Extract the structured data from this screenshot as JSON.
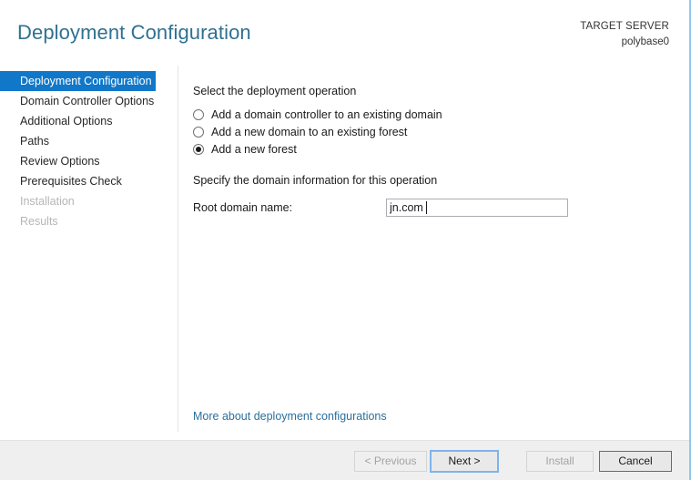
{
  "header": {
    "title": "Deployment Configuration",
    "target_server_label": "TARGET SERVER",
    "target_server_name": "polybase0"
  },
  "sidebar": {
    "items": [
      {
        "label": "Deployment Configuration",
        "state": "selected"
      },
      {
        "label": "Domain Controller Options",
        "state": "enabled"
      },
      {
        "label": "Additional Options",
        "state": "enabled"
      },
      {
        "label": "Paths",
        "state": "enabled"
      },
      {
        "label": "Review Options",
        "state": "enabled"
      },
      {
        "label": "Prerequisites Check",
        "state": "enabled"
      },
      {
        "label": "Installation",
        "state": "disabled"
      },
      {
        "label": "Results",
        "state": "disabled"
      }
    ]
  },
  "main": {
    "operation_section_label": "Select the deployment operation",
    "radio_options": [
      {
        "label": "Add a domain controller to an existing domain",
        "checked": false
      },
      {
        "label": "Add a new domain to an existing forest",
        "checked": false
      },
      {
        "label": "Add a new forest",
        "checked": true
      }
    ],
    "domain_section_label": "Specify the domain information for this operation",
    "root_domain_field_label": "Root domain name:",
    "root_domain_value": "jn.com",
    "root_domain_placeholder": "",
    "more_link_label": "More about deployment configurations"
  },
  "footer": {
    "previous_label": "< Previous",
    "next_label": "Next >",
    "install_label": "Install",
    "cancel_label": "Cancel"
  },
  "colors": {
    "accent_blue": "#1177c8",
    "title_teal": "#30718f",
    "link_blue": "#2a6f9c",
    "focus_blue": "#7eb4ea",
    "footer_grey": "#efeff0",
    "window_border": "#8ec8ef"
  }
}
